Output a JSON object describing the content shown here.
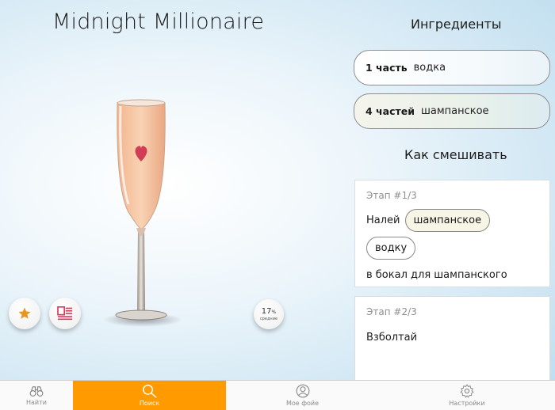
{
  "drink": {
    "title": "Midnight Millionaire",
    "strength": {
      "value": "17",
      "unit": "%",
      "label": "средние"
    }
  },
  "ingredients": {
    "heading": "Ингредиенты",
    "items": [
      {
        "qty": "1 часть",
        "name": "водка"
      },
      {
        "qty": "4 частей",
        "name": "шампанское"
      }
    ]
  },
  "mixing": {
    "heading": "Как смешивать",
    "steps": [
      {
        "label": "Этап #1/3",
        "prefix": "Налей",
        "chips": [
          "шампанское",
          "водку"
        ],
        "tail": "в бокал для шампанского"
      },
      {
        "label": "Этап #2/3",
        "text": "Взболтай"
      }
    ]
  },
  "tabs": [
    {
      "label": "Найти",
      "icon": "binoculars-icon",
      "active": false
    },
    {
      "label": "Поиск",
      "icon": "search-icon",
      "active": true
    },
    {
      "label": "Мое фойе",
      "icon": "person-icon",
      "active": false
    },
    {
      "label": "Настройки",
      "icon": "gear-icon",
      "active": false
    }
  ],
  "colors": {
    "accent": "#ff9a00",
    "favorite": "#e8961e",
    "recipe": "#e2345c"
  }
}
